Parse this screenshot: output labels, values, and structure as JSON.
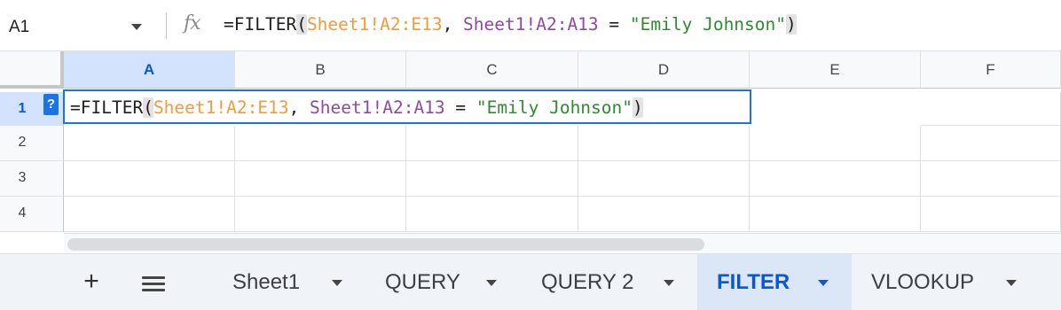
{
  "formula_bar": {
    "cell_ref": "A1",
    "fx_label": "fx",
    "formula": {
      "prefix": "=FILTER",
      "open_paren": "(",
      "range1": "Sheet1!A2:E13",
      "sep1": ", ",
      "range2": "Sheet1!A2:A13",
      "op": " = ",
      "string": "\"Emily Johnson\"",
      "close_paren": ")"
    }
  },
  "grid": {
    "columns": [
      "A",
      "B",
      "C",
      "D",
      "E",
      "F"
    ],
    "rows": [
      "1",
      "2",
      "3",
      "4"
    ],
    "selected_column": "A",
    "selected_row": "1",
    "help_badge": "?"
  },
  "sheet_tabs": {
    "add_label": "+",
    "tabs": [
      {
        "label": "Sheet1"
      },
      {
        "label": "QUERY"
      },
      {
        "label": "QUERY 2"
      },
      {
        "label": "FILTER",
        "active": true
      },
      {
        "label": "VLOOKUP"
      }
    ]
  },
  "colors": {
    "accent": "#1a73e8",
    "range1": "#f29b3c",
    "range2": "#8e4aa3",
    "string": "#2f8a2f",
    "active_tab_bg": "#dbe6f7"
  }
}
